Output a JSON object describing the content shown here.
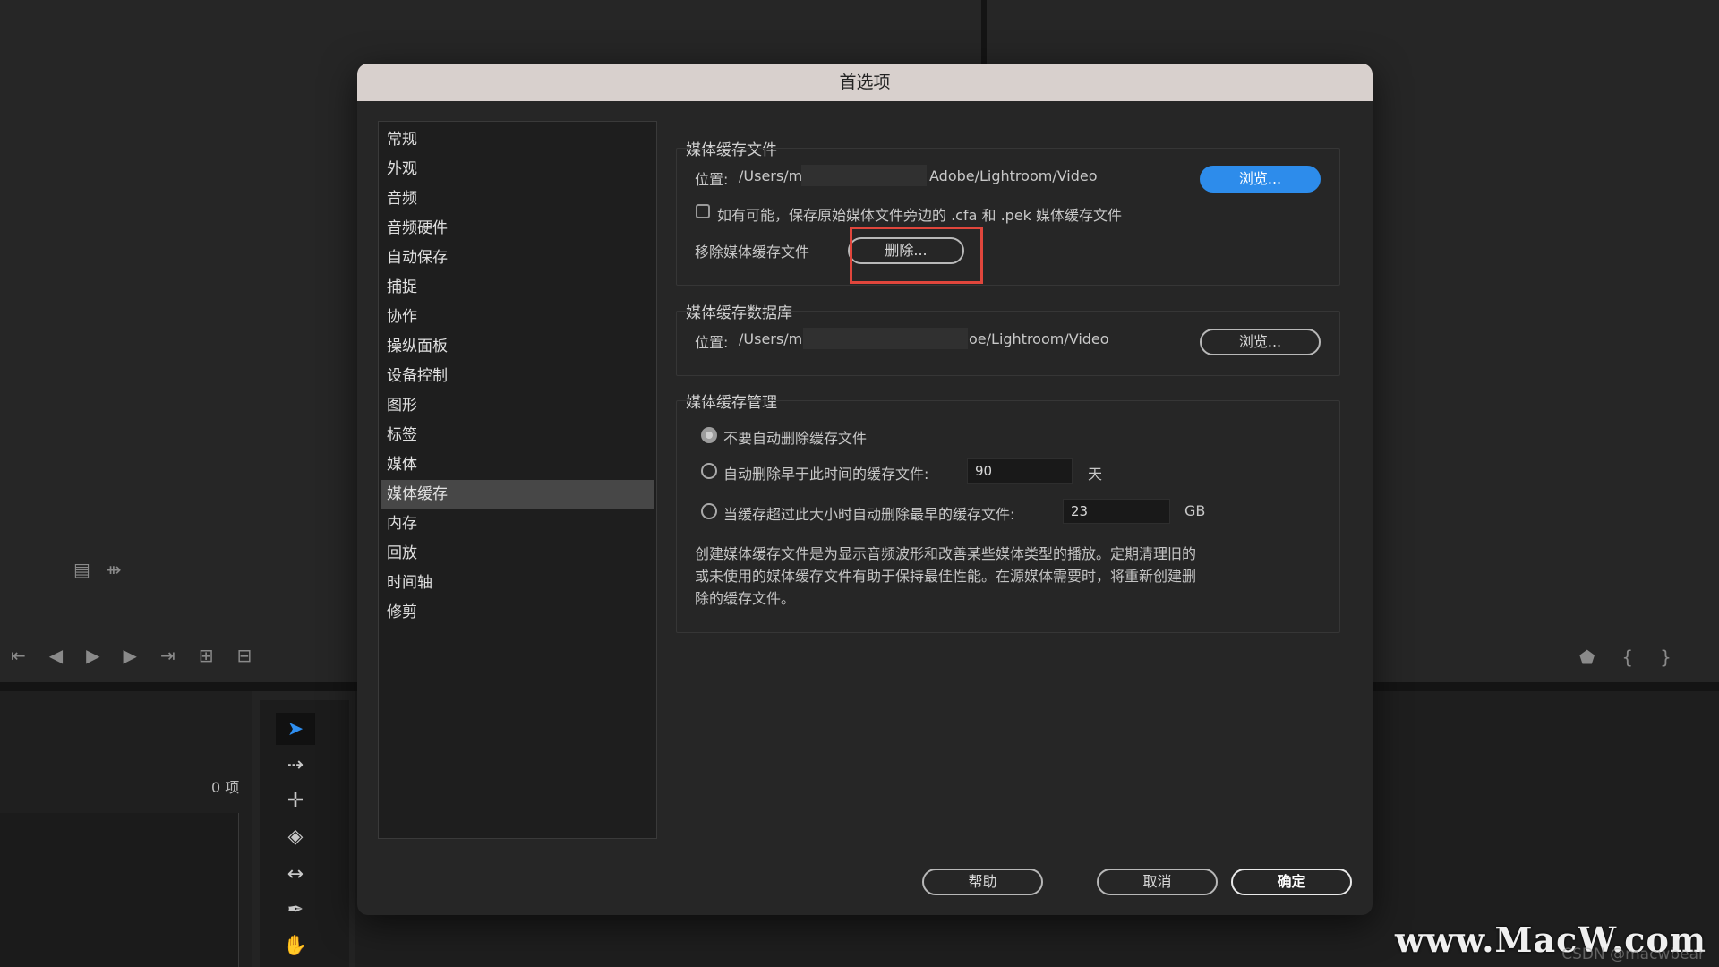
{
  "background": {
    "items_count": "0 项",
    "watermark": "www.MacW.com",
    "credit": "CSDN @macwbear"
  },
  "dialog": {
    "title": "首选项",
    "sidebar": {
      "items": [
        "常规",
        "外观",
        "音频",
        "音频硬件",
        "自动保存",
        "捕捉",
        "协作",
        "操纵面板",
        "设备控制",
        "图形",
        "标签",
        "媒体",
        "媒体缓存",
        "内存",
        "回放",
        "时间轴",
        "修剪"
      ],
      "selected": "媒体缓存"
    },
    "cache_files": {
      "title": "媒体缓存文件",
      "location_label": "位置:",
      "location_start": "/Users/ma",
      "location_end": "Adobe/Lightroom/Video",
      "browse_label": "浏览...",
      "save_next_to_originals_label": "如有可能，保存原始媒体文件旁边的 .cfa 和 .pek 媒体缓存文件",
      "save_next_to_originals_checked": false,
      "remove_label": "移除媒体缓存文件",
      "delete_label": "删除..."
    },
    "cache_database": {
      "title": "媒体缓存数据库",
      "location_label": "位置:",
      "location_start": "/Users/ma",
      "location_end": "oe/Lightroom/Video",
      "browse_label": "浏览..."
    },
    "cache_management": {
      "title": "媒体缓存管理",
      "option_never": "不要自动删除缓存文件",
      "option_older_than": "自动删除早于此时间的缓存文件:",
      "days_value": "90",
      "days_unit": "天",
      "option_exceeds_size": "当缓存超过此大小时自动删除最早的缓存文件:",
      "size_value": "23",
      "size_unit": "GB",
      "selected_option": "option_never",
      "description_lines": [
        "创建媒体缓存文件是为显示音频波形和改善某些媒体类型的播放。定期清理旧的",
        "或未使用的媒体缓存文件有助于保持最佳性能。在源媒体需要时，将重新创建删",
        "除的缓存文件。"
      ]
    },
    "footer": {
      "help_label": "帮助",
      "cancel_label": "取消",
      "ok_label": "确定"
    }
  },
  "colors": {
    "accent": "#2d8ceb",
    "highlight": "#e0463c"
  }
}
